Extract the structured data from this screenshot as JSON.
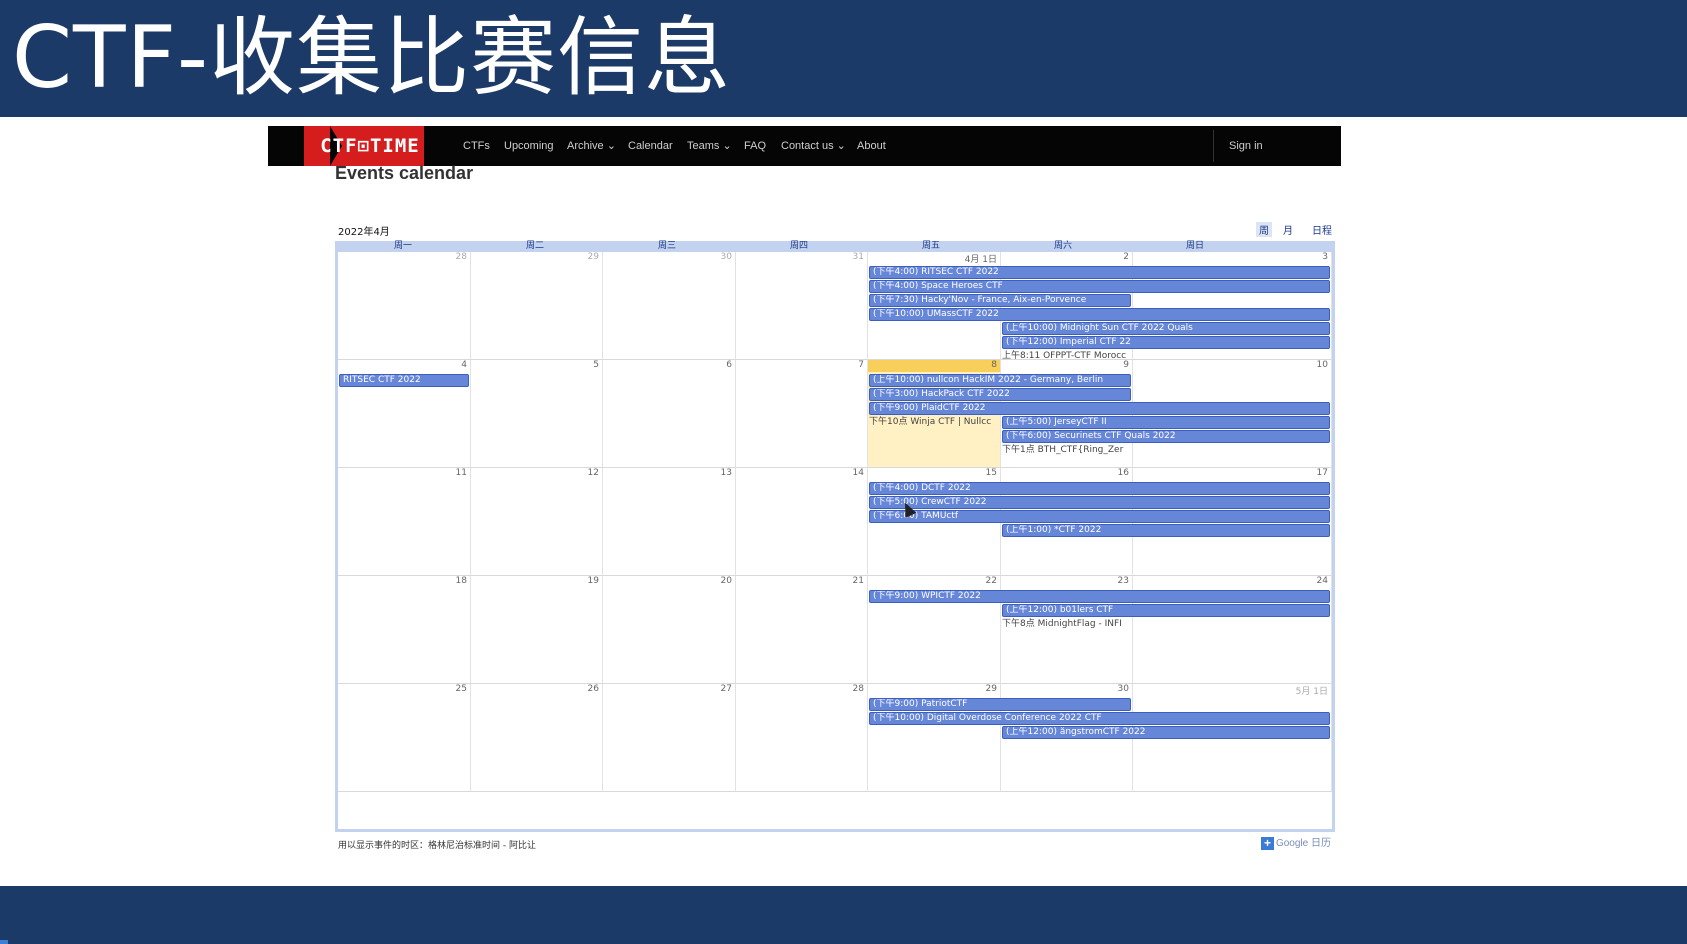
{
  "slide": {
    "title": "CTF-收集比赛信息"
  },
  "navbar": {
    "logo": "CTF⊡TIME",
    "items": [
      {
        "label": "CTFs"
      },
      {
        "label": "Upcoming"
      },
      {
        "label": "Archive ⌄"
      },
      {
        "label": "Calendar"
      },
      {
        "label": "Teams ⌄"
      },
      {
        "label": "FAQ"
      },
      {
        "label": "Contact us ⌄"
      },
      {
        "label": "About"
      }
    ],
    "sign_in": "Sign in"
  },
  "page": {
    "heading": "Events calendar"
  },
  "calendar": {
    "month_label": "2022年4月",
    "views": [
      {
        "label": "周",
        "active": true
      },
      {
        "label": "月",
        "active": false
      },
      {
        "label": "日程",
        "active": false
      }
    ],
    "weekdays": [
      "周一",
      "周二",
      "周三",
      "周四",
      "周五",
      "周六",
      "周日"
    ],
    "weeks": [
      {
        "days": [
          {
            "label": "28",
            "dim": true
          },
          {
            "label": "29",
            "dim": true
          },
          {
            "label": "30",
            "dim": true
          },
          {
            "label": "31",
            "dim": true
          },
          {
            "label": "4月 1日"
          },
          {
            "label": "2"
          },
          {
            "label": "3"
          }
        ],
        "events": [
          {
            "text": "(下午4:00) RITSEC CTF 2022",
            "start": 4,
            "span": 3,
            "kind": "bar",
            "cont_right": true
          },
          {
            "text": "(下午4:00) Space Heroes CTF",
            "start": 4,
            "span": 3,
            "kind": "bar"
          },
          {
            "text": "(下午7:30) Hacky'Nov - France, Aix-en-Porvence",
            "start": 4,
            "span": 2,
            "kind": "bar"
          },
          {
            "text": "(下午10:00) UMassCTF 2022",
            "start": 4,
            "span": 3,
            "kind": "bar"
          },
          {
            "text": "(上午10:00) Midnight Sun CTF 2022 Quals",
            "start": 5,
            "span": 2,
            "kind": "bar"
          },
          {
            "text": "(下午12:00) Imperial CTF 22",
            "start": 5,
            "span": 2,
            "kind": "bar"
          },
          {
            "text": "上午8:11 OFPPT-CTF Morocc",
            "start": 5,
            "span": 1,
            "kind": "plain"
          }
        ]
      },
      {
        "days": [
          {
            "label": "4"
          },
          {
            "label": "5"
          },
          {
            "label": "6"
          },
          {
            "label": "7"
          },
          {
            "label": "8",
            "today": true
          },
          {
            "label": "9"
          },
          {
            "label": "10"
          }
        ],
        "events": [
          {
            "text": "RITSEC CTF 2022",
            "start": 0,
            "span": 1,
            "kind": "bar"
          },
          {
            "text": "(上午10:00) nullcon HackIM 2022 - Germany, Berlin",
            "start": 4,
            "span": 2,
            "kind": "bar"
          },
          {
            "text": "(下午3:00) HackPack CTF 2022",
            "start": 4,
            "span": 2,
            "kind": "bar"
          },
          {
            "text": "(下午9:00) PlaidCTF 2022",
            "start": 4,
            "span": 3,
            "kind": "bar"
          },
          {
            "text": "下午10点 Winja CTF | Nullcc",
            "start": 4,
            "span": 1,
            "kind": "plain",
            "row": 3
          },
          {
            "text": "(上午5:00) JerseyCTF II",
            "start": 5,
            "span": 2,
            "kind": "bar",
            "row": 3
          },
          {
            "text": "(下午6:00) Securinets CTF Quals 2022",
            "start": 5,
            "span": 2,
            "kind": "bar"
          },
          {
            "text": "下午1点 BTH_CTF{Ring_Zer",
            "start": 5,
            "span": 1,
            "kind": "plain"
          }
        ]
      },
      {
        "days": [
          {
            "label": "11"
          },
          {
            "label": "12"
          },
          {
            "label": "13"
          },
          {
            "label": "14"
          },
          {
            "label": "15"
          },
          {
            "label": "16"
          },
          {
            "label": "17"
          }
        ],
        "events": [
          {
            "text": "(下午4:00) DCTF 2022",
            "start": 4,
            "span": 3,
            "kind": "bar"
          },
          {
            "text": "(下午5:00) CrewCTF 2022",
            "start": 4,
            "span": 3,
            "kind": "bar"
          },
          {
            "text": "(下午6:00) TAMUctf",
            "start": 4,
            "span": 3,
            "kind": "bar"
          },
          {
            "text": "(上午1:00) *CTF 2022",
            "start": 5,
            "span": 2,
            "kind": "bar"
          }
        ]
      },
      {
        "days": [
          {
            "label": "18"
          },
          {
            "label": "19"
          },
          {
            "label": "20"
          },
          {
            "label": "21"
          },
          {
            "label": "22"
          },
          {
            "label": "23"
          },
          {
            "label": "24"
          }
        ],
        "events": [
          {
            "text": "(下午9:00) WPICTF 2022",
            "start": 4,
            "span": 3,
            "kind": "bar"
          },
          {
            "text": "(上午12:00) b01lers CTF",
            "start": 5,
            "span": 2,
            "kind": "bar"
          },
          {
            "text": "下午8点 MidnightFlag - INFI",
            "start": 5,
            "span": 1,
            "kind": "plain"
          }
        ]
      },
      {
        "days": [
          {
            "label": "25"
          },
          {
            "label": "26"
          },
          {
            "label": "27"
          },
          {
            "label": "28"
          },
          {
            "label": "29"
          },
          {
            "label": "30"
          },
          {
            "label": "5月 1日",
            "dim": true
          }
        ],
        "events": [
          {
            "text": "(下午9:00) PatriotCTF",
            "start": 4,
            "span": 2,
            "kind": "bar"
          },
          {
            "text": "(下午10:00) Digital Overdose Conference 2022 CTF",
            "start": 4,
            "span": 3,
            "kind": "bar"
          },
          {
            "text": "(上午12:00) ångstromCTF 2022",
            "start": 5,
            "span": 2,
            "kind": "bar",
            "cont_right": true
          }
        ]
      }
    ],
    "timezone_note": "用以显示事件的时区：格林尼治标准时间 - 阿比让",
    "google_badge": "Google 日历"
  }
}
